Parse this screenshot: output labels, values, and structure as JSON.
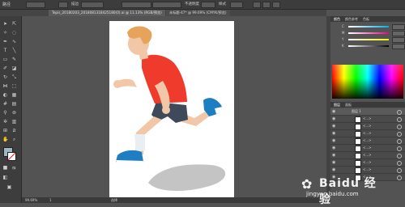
{
  "app": {
    "menu_title": "路径",
    "toolbar_labels": {
      "stroke": "描边",
      "opacity": "不透明度",
      "style": "样式"
    }
  },
  "tabs": [
    {
      "label": "Tepis_20180203_2018081318425180(0).ai @ 11.13% (RGB/预览)"
    },
    {
      "label": "未标题-47* @ 99.69% (CMYK/预览)"
    }
  ],
  "panels": {
    "color": {
      "tabs": [
        "颜色",
        "颜色参考",
        "色板"
      ],
      "sliders": [
        "C",
        "M",
        "Y",
        "K"
      ]
    },
    "layers": {
      "tabs": [
        "图层",
        "画板"
      ],
      "rows": [
        {
          "name": "图层 1"
        },
        {
          "name": "<...>"
        },
        {
          "name": "<...>"
        },
        {
          "name": "<...>"
        },
        {
          "name": "<...>"
        },
        {
          "name": "<...>"
        },
        {
          "name": "<...>"
        },
        {
          "name": "<...>"
        },
        {
          "name": "<...>"
        },
        {
          "name": "<...>"
        }
      ]
    }
  },
  "statusbar": {
    "zoom": "99.69%",
    "page": "1",
    "tool": "选择"
  },
  "watermark": {
    "big": "Baidu 经验",
    "small": "jingyan.baidu.com"
  },
  "colors": {
    "shirt": "#ee3b2b",
    "shorts": "#3e4a5a",
    "skin": "#f1c7a8",
    "hair": "#e8a35a",
    "shoe": "#1d7fc1",
    "shadow": "#c4c4c4"
  }
}
